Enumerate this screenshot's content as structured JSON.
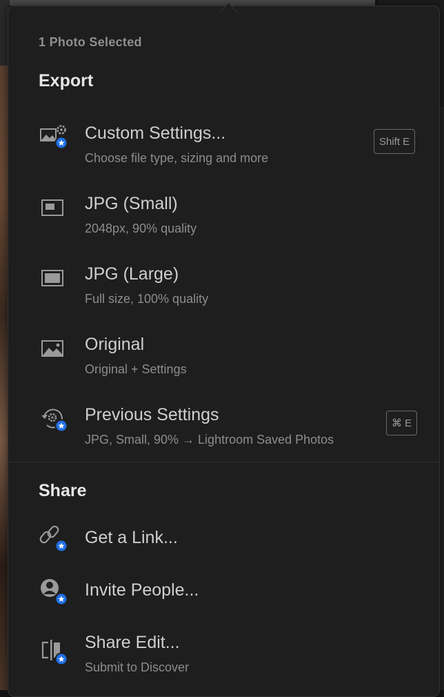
{
  "colors": {
    "panel_bg": "#1e1e1e",
    "accent_badge": "#1f6fe5",
    "text_primary": "#cfcfcf",
    "text_secondary": "#8d8d8d"
  },
  "context": "1 Photo Selected",
  "export": {
    "title": "Export",
    "items": [
      {
        "label": "Custom Settings...",
        "sub": "Choose file type, sizing and more",
        "shortcut": "Shift E",
        "icon": "custom-settings-icon"
      },
      {
        "label": "JPG (Small)",
        "sub": "2048px, 90% quality",
        "icon": "jpg-small-icon"
      },
      {
        "label": "JPG (Large)",
        "sub": "Full size, 100% quality",
        "icon": "jpg-large-icon"
      },
      {
        "label": "Original",
        "sub": "Original + Settings",
        "icon": "image-icon"
      },
      {
        "label": "Previous Settings",
        "sub": "JPG, Small, 90% → Lightroom Saved Photos",
        "shortcut": "⌘ E",
        "icon": "previous-settings-icon"
      }
    ]
  },
  "share": {
    "title": "Share",
    "items": [
      {
        "label": "Get a Link...",
        "icon": "link-icon"
      },
      {
        "label": "Invite People...",
        "icon": "invite-people-icon"
      },
      {
        "label": "Share Edit...",
        "sub": "Submit to Discover",
        "icon": "share-edit-icon"
      }
    ]
  }
}
